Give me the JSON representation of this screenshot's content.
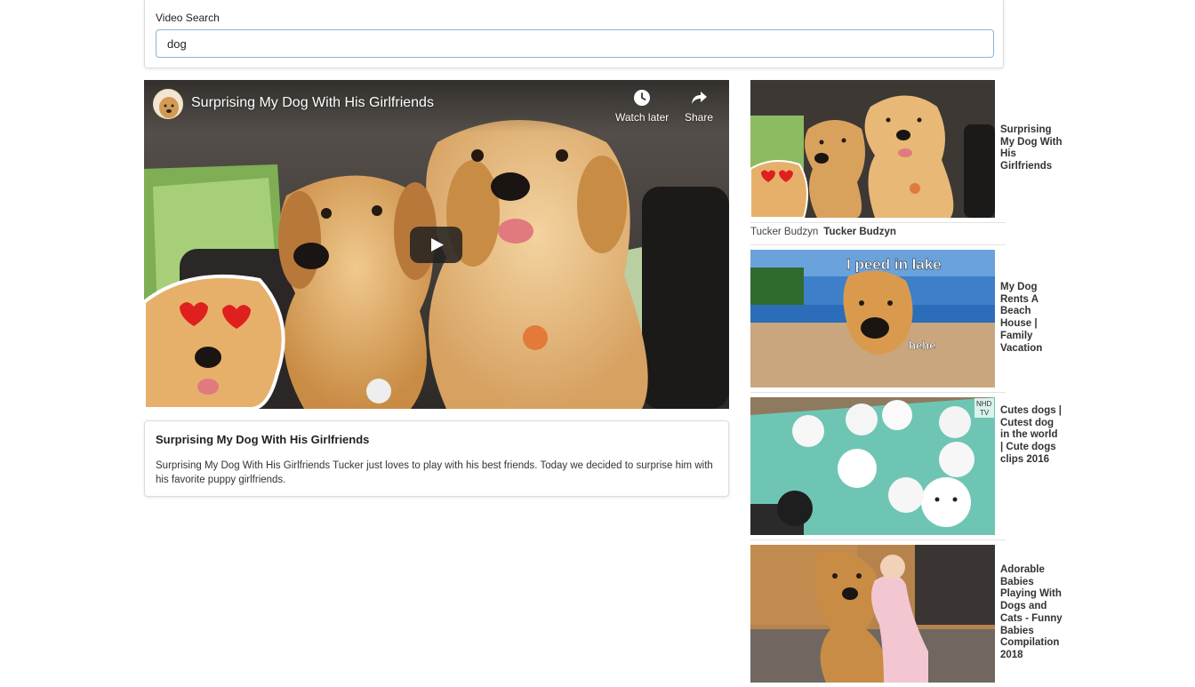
{
  "search": {
    "label": "Video Search",
    "value": "dog"
  },
  "player": {
    "title": "Surprising My Dog With His Girlfriends",
    "watch_later": "Watch later",
    "share": "Share"
  },
  "selected": {
    "title": "Surprising My Dog With His Girlfriends",
    "description": "Surprising My Dog With His Girlfriends Tucker just loves to play with his best friends. Today we decided to surprise him with his favorite puppy girlfriends."
  },
  "video_list": [
    {
      "title": "Surprising My Dog With His Girlfriends"
    },
    {
      "broken_image_alt": "Tucker Budzyn",
      "channel": "Tucker Budzyn"
    },
    {
      "title": "My Dog Rents A Beach House | Family Vacation",
      "overlay_top": "I peed in lake",
      "overlay_bottom": "hehe"
    },
    {
      "title": "Cutes dogs | Cutest dog in the world | Cute dogs clips 2016",
      "badge_line1": "NHD",
      "badge_line2": "TV"
    },
    {
      "title": "Adorable Babies Playing With Dogs and Cats - Funny Babies Compilation 2018"
    }
  ]
}
